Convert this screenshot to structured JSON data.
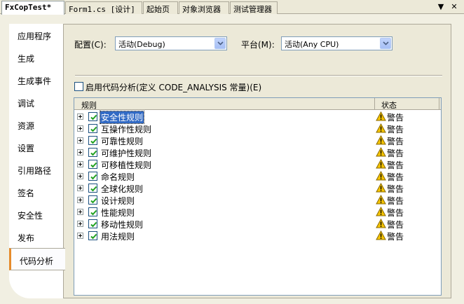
{
  "tabs": [
    {
      "label": "FxCopTest*",
      "active": true
    },
    {
      "label": "Form1.cs [设计]"
    },
    {
      "label": "起始页"
    },
    {
      "label": "对象浏览器"
    },
    {
      "label": "测试管理器"
    }
  ],
  "strip_buttons": {
    "dropdown": "▼",
    "close": "✕"
  },
  "sidebar": {
    "items": [
      {
        "label": "应用程序"
      },
      {
        "label": "生成"
      },
      {
        "label": "生成事件"
      },
      {
        "label": "调试"
      },
      {
        "label": "资源"
      },
      {
        "label": "设置"
      },
      {
        "label": "引用路径"
      },
      {
        "label": "签名"
      },
      {
        "label": "安全性"
      },
      {
        "label": "发布"
      },
      {
        "label": "代码分析",
        "selected": true
      }
    ]
  },
  "config": {
    "label": "配置(C):",
    "value": "活动(Debug)"
  },
  "platform": {
    "label": "平台(M):",
    "value": "活动(Any CPU)"
  },
  "enable_analysis": {
    "label": "启用代码分析(定义 CODE_ANALYSIS 常量)(E)",
    "checked": false
  },
  "grid": {
    "columns": [
      "规则",
      "状态"
    ],
    "rows": [
      {
        "name": "安全性规则",
        "status": "警告",
        "selected": true
      },
      {
        "name": "互操作性规则",
        "status": "警告"
      },
      {
        "name": "可靠性规则",
        "status": "警告"
      },
      {
        "name": "可维护性规则",
        "status": "警告"
      },
      {
        "name": "可移植性规则",
        "status": "警告"
      },
      {
        "name": "命名规则",
        "status": "警告"
      },
      {
        "name": "全球化规则",
        "status": "警告"
      },
      {
        "name": "设计规则",
        "status": "警告"
      },
      {
        "name": "性能规则",
        "status": "警告"
      },
      {
        "name": "移动性规则",
        "status": "警告"
      },
      {
        "name": "用法规则",
        "status": "警告"
      }
    ]
  },
  "colors": {
    "selection": "#316ac5",
    "warning_icon": "#f5c400",
    "checkmark": "#21a121",
    "selected_tab_accent": "#e68b2c"
  }
}
